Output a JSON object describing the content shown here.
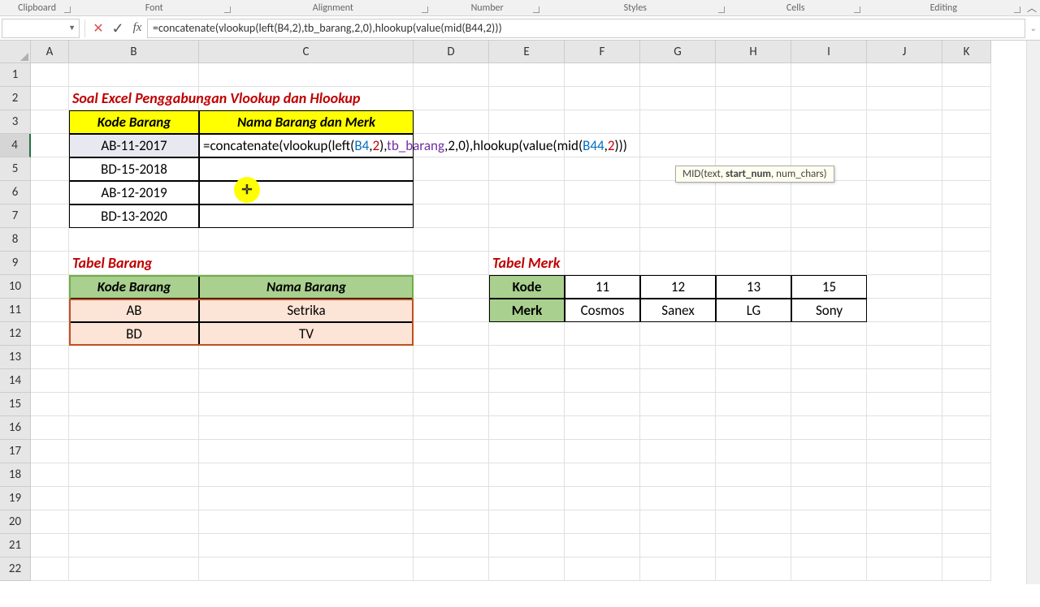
{
  "ribbon": {
    "groups": [
      "Clipboard",
      "Font",
      "Alignment",
      "Number",
      "Styles",
      "Cells",
      "Editing"
    ]
  },
  "formula_bar": {
    "name_box": "",
    "formula": "=concatenate(vlookup(left(B4,2),tb_barang,2,0),hlookup(value(mid(B44,2)))"
  },
  "columns": [
    "A",
    "B",
    "C",
    "D",
    "E",
    "F",
    "G",
    "H",
    "I",
    "J",
    "K"
  ],
  "rows": [
    "1",
    "2",
    "3",
    "4",
    "5",
    "6",
    "7",
    "8",
    "9",
    "10",
    "11",
    "12",
    "13",
    "14",
    "15",
    "16",
    "17",
    "18",
    "19",
    "20",
    "21",
    "22"
  ],
  "sheet": {
    "title": "Soal Excel Penggabungan Vlookup dan Hlookup",
    "header_kode": "Kode Barang",
    "header_nama": "Nama Barang dan Merk",
    "kode_items": [
      "AB-11-2017",
      "BD-15-2018",
      "AB-12-2019",
      "BD-13-2020"
    ],
    "formula_cell": "=concatenate(vlookup(left(B4,2),tb_barang,2,0),hlookup(value(mid(B44,2)))",
    "tabel_barang_title": "Tabel Barang",
    "tabel_barang_h1": "Kode Barang",
    "tabel_barang_h2": "Nama Barang",
    "tabel_barang_rows": [
      {
        "kode": "AB",
        "nama": "Setrika"
      },
      {
        "kode": "BD",
        "nama": "TV"
      }
    ],
    "tabel_merk_title": "Tabel Merk",
    "tabel_merk_kode_label": "Kode",
    "tabel_merk_merk_label": "Merk",
    "tabel_merk_kodes": [
      "11",
      "12",
      "13",
      "15"
    ],
    "tabel_merk_merks": [
      "Cosmos",
      "Sanex",
      "LG",
      "Sony"
    ]
  },
  "tooltip": "MID(text, start_num, num_chars)",
  "tooltip_bold": "start_num"
}
